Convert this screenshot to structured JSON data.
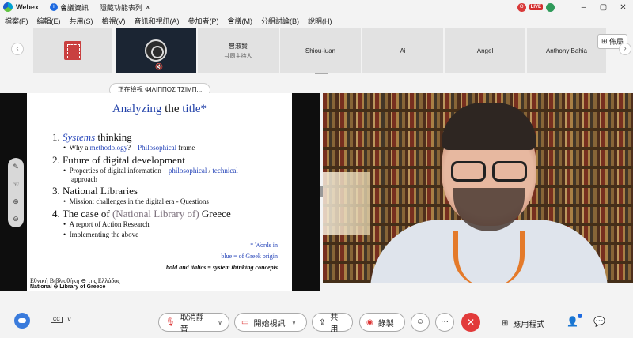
{
  "titlebar": {
    "app_name": "Webex",
    "meeting_info": "會議資訊",
    "hide_list": "隱藏功能表列",
    "rec_label": "O",
    "live_label": "LIVE",
    "win_min": "–",
    "win_max": "▢",
    "win_close": "✕"
  },
  "menu": [
    "檔案(F)",
    "編輯(E)",
    "共用(S)",
    "檢視(V)",
    "音訊和視訊(A)",
    "參加者(P)",
    "會議(M)",
    "分組討論(B)",
    "說明(H)"
  ],
  "filmstrip": {
    "tiles": [
      {
        "name": "曾淑賢",
        "sub": "共同主持人"
      },
      {
        "name": "Shiou-iuan",
        "sub": ""
      },
      {
        "name": "Ai",
        "sub": ""
      },
      {
        "name": "Angel",
        "sub": ""
      },
      {
        "name": "Anthony Bahia",
        "sub": ""
      }
    ],
    "layout_label": "佈局",
    "mute_mark": "🔇"
  },
  "viewing": "正在檢視 ΦΙΛΙΠΠΟΣ ΤΣΙΜΠ...",
  "slide": {
    "title_a": "Analyzing",
    "title_b": " the ",
    "title_c": "title*",
    "h1_num": "1. ",
    "h1_it": "Systems",
    "h1_rest": " thinking",
    "b1_pre": "Why a ",
    "b1_blue": "methodology",
    "b1_mid": "? – ",
    "b1_blue2": "Philosophical",
    "b1_post": " frame",
    "h2": "2. Future of digital development",
    "b2_pre": "Properties of digital information – ",
    "b2_blue": "philosophical",
    "b2_sep": " / ",
    "b2_blue2": "technical",
    "b2_post": "approach",
    "h3": "3. National Libraries",
    "b3": "Mission: challenges in the digital era - Questions",
    "h4_pre": "4. The case of ",
    "h4_grey": "(National Library of)",
    "h4_post": " Greece",
    "b4a": "A report of Action Research",
    "b4b": "Implementing the above",
    "note1": "* Words in",
    "note2": "blue = of Greek origin",
    "note3": "bold and italics = system thinking concepts",
    "footer_gr": "Εθνική Βιβλιοθήκη ⊖ της Ελλάδος",
    "footer_en": "National ⊖ Library of Greece"
  },
  "controls": {
    "cc": "CC",
    "unmute": "取消靜音",
    "start_video": "開始視訊",
    "share": "共用",
    "record": "錄製",
    "react_icon": "☺",
    "more": "···",
    "end": "✕",
    "apps": "應用程式",
    "participants_icon": "👤",
    "chat_icon": "💬"
  }
}
